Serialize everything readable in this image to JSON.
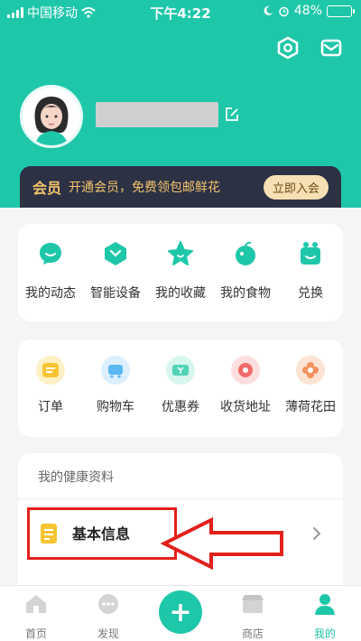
{
  "status_bar": {
    "carrier": "中国移动",
    "time": "下午4:22",
    "battery": "48%",
    "battery_level": 0.48
  },
  "header": {
    "settings_icon": "hexagon-settings-icon",
    "message_icon": "envelope-icon",
    "edit_icon": "edit-icon"
  },
  "vip": {
    "label": "会员",
    "text": "开通会员，免费领包邮鲜花",
    "button": "立即入会"
  },
  "grid1": [
    {
      "label": "我的动态",
      "icon": "chat-bubble-icon",
      "color": "#1fc7a9"
    },
    {
      "label": "智能设备",
      "icon": "device-icon",
      "color": "#1fc7a9"
    },
    {
      "label": "我的收藏",
      "icon": "star-icon",
      "color": "#1fc7a9"
    },
    {
      "label": "我的食物",
      "icon": "apple-icon",
      "color": "#1fc7a9"
    },
    {
      "label": "兑换",
      "icon": "gift-icon",
      "color": "#1fc7a9"
    }
  ],
  "grid2": [
    {
      "label": "订单",
      "icon": "order-icon",
      "color": "#f7c533"
    },
    {
      "label": "购物车",
      "icon": "cart-icon",
      "color": "#5bb7ef"
    },
    {
      "label": "优惠券",
      "icon": "coupon-icon",
      "color": "#4fd4b6"
    },
    {
      "label": "收货地址",
      "icon": "location-icon",
      "color": "#f26a6a"
    },
    {
      "label": "薄荷花田",
      "icon": "flower-icon",
      "color": "#f4915c"
    }
  ],
  "health": {
    "title": "我的健康资料",
    "basic_info": "基本信息"
  },
  "tabbar": [
    {
      "label": "首页",
      "icon": "home-icon"
    },
    {
      "label": "发现",
      "icon": "discover-icon"
    },
    {
      "label": "商店",
      "icon": "store-icon"
    },
    {
      "label": "我的",
      "icon": "profile-icon"
    }
  ]
}
